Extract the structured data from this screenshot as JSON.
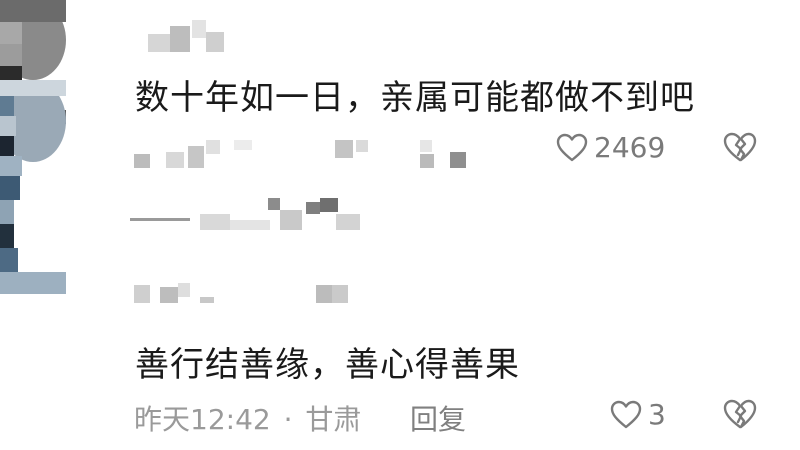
{
  "comments": [
    {
      "text": "数十年如一日，亲属可能都做不到吧",
      "likes": "2469"
    },
    {
      "text": "善行结善缘，善心得善果",
      "time": "昨天12:42",
      "separator": "·",
      "location": "甘肃",
      "reply_label": "回复",
      "likes": "3"
    }
  ],
  "icons": {
    "like": "heart-outline-icon",
    "dislike": "broken-heart-icon"
  },
  "colors": {
    "text": "#1a1a1a",
    "meta": "#9a9a9a",
    "icon": "#7a7a7a"
  }
}
